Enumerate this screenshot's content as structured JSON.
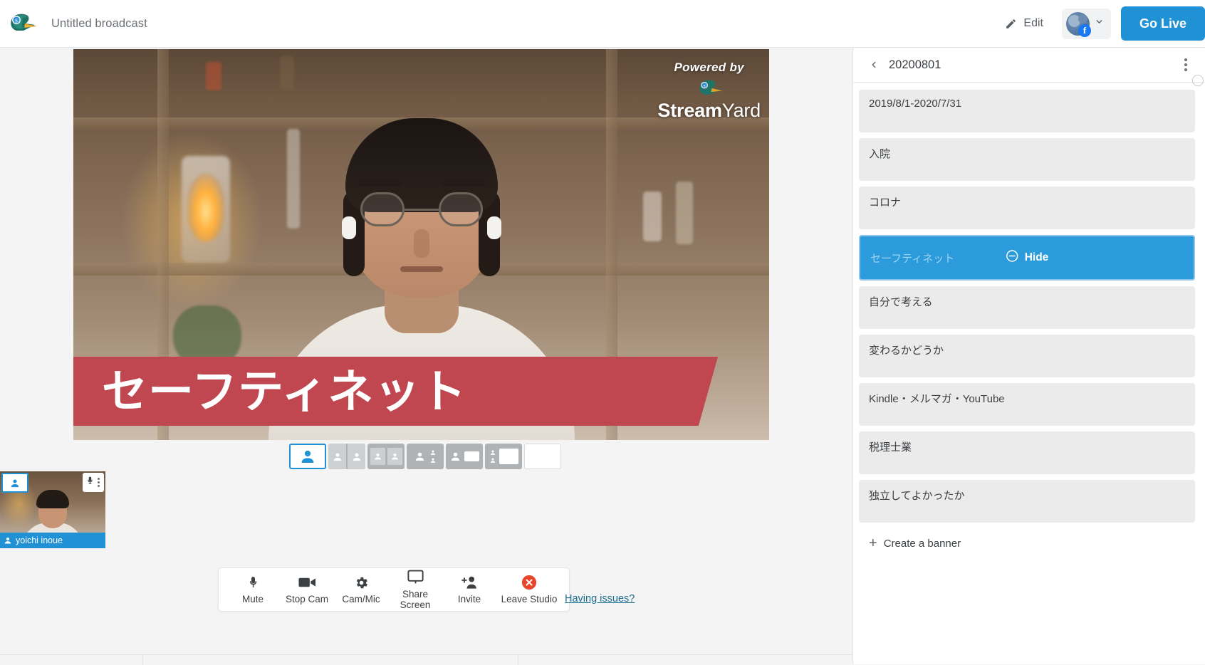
{
  "topbar": {
    "logo_icon": "duck-logo-icon",
    "broadcast_title": "Untitled broadcast",
    "edit_label": "Edit",
    "edit_icon": "pencil-icon",
    "destination_icon": "facebook-badge-icon",
    "destination_chevron_icon": "chevron-down-icon",
    "go_live_label": "Go Live"
  },
  "video": {
    "watermark_powered": "Powered by",
    "watermark_brand_bold": "Stream",
    "watermark_brand_thin": "Yard",
    "watermark_logo_icon": "duck-logo-icon",
    "banner_text": "セーフティネット",
    "banner_color": "#c0474f"
  },
  "layout_selector": {
    "selected_index": 0,
    "options": [
      {
        "name": "layout-single-speaker",
        "icon": "single-person-icon"
      },
      {
        "name": "layout-two-split",
        "icon": "two-person-split-icon"
      },
      {
        "name": "layout-two-group",
        "icon": "two-person-group-icon"
      },
      {
        "name": "layout-one-plus-two",
        "icon": "one-plus-two-icon"
      },
      {
        "name": "layout-person-screen",
        "icon": "person-screen-icon"
      },
      {
        "name": "layout-stack-screen",
        "icon": "stack-screen-icon"
      },
      {
        "name": "layout-screen-only",
        "icon": "screen-only-icon"
      }
    ]
  },
  "self_view": {
    "participant_name": "yoichi inoue",
    "name_icon": "person-icon",
    "layout_badge_icon": "person-icon",
    "mic_icon": "microphone-icon",
    "kebab_icon": "more-vertical-icon"
  },
  "toolbar": {
    "buttons": [
      {
        "label": "Mute",
        "icon": "microphone-icon",
        "name": "mute-button"
      },
      {
        "label": "Stop Cam",
        "icon": "video-camera-icon",
        "name": "stop-cam-button"
      },
      {
        "label": "Cam/Mic",
        "icon": "gear-icon",
        "name": "cam-mic-button"
      },
      {
        "label": "Share Screen",
        "icon": "monitor-icon",
        "name": "share-screen-button"
      },
      {
        "label": "Invite",
        "icon": "add-person-icon",
        "name": "invite-button"
      },
      {
        "label": "Leave Studio",
        "icon": "close-circle-icon",
        "name": "leave-studio-button"
      }
    ],
    "having_issues_label": "Having issues?",
    "leave_icon_color": "#e8452c"
  },
  "sidebar": {
    "back_icon": "chevron-left-icon",
    "title": "20200801",
    "kebab_icon": "more-vertical-icon",
    "hide_label": "Hide",
    "hide_icon": "minus-circle-icon",
    "create_banner_label": "Create a banner",
    "create_banner_icon": "plus-icon",
    "active_index": 3,
    "banners": [
      {
        "text": "2019/8/1-2020/7/31"
      },
      {
        "text": "入院"
      },
      {
        "text": "コロナ"
      },
      {
        "text": "セーフティネット"
      },
      {
        "text": "自分で考える"
      },
      {
        "text": "変わるかどうか"
      },
      {
        "text": "Kindle・メルマガ・YouTube"
      },
      {
        "text": "税理士業"
      },
      {
        "text": "独立してよかったか"
      }
    ]
  },
  "colors": {
    "accent_blue": "#2191d6",
    "banner_red": "#c0474f",
    "leave_red": "#e8452c",
    "panel_gray": "#ebebec"
  }
}
